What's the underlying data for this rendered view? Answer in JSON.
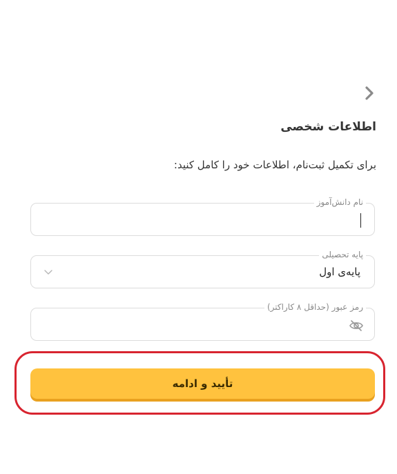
{
  "header": {
    "back_icon": "chevron-right-icon",
    "title": "اطلاعات شخصی"
  },
  "description": "برای تکمیل ثبت‌نام، اطلاعات خود را کامل کنید:",
  "form": {
    "name": {
      "label": "نام دانش‌آموز",
      "value": ""
    },
    "grade": {
      "label": "پایه تحصیلی",
      "value": "پایه‌ی اول",
      "dropdown_icon": "chevron-down-icon"
    },
    "password": {
      "label": "رمز عبور (حداقل ۸ کاراکتر)",
      "value": "",
      "toggle_icon": "eye-off-icon"
    }
  },
  "submit": {
    "label": "تأیید و ادامه"
  },
  "colors": {
    "accent": "#ffc23e",
    "accent_shadow": "#e9a11f",
    "highlight": "#d8242f",
    "border": "#dcdcdc"
  }
}
